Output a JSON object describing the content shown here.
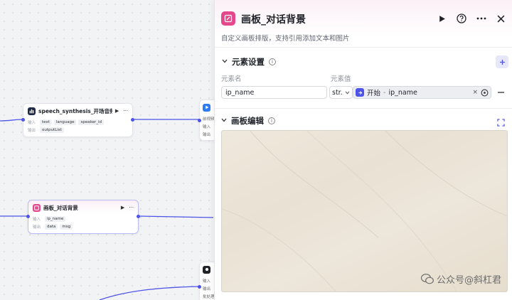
{
  "nodes": {
    "speech": {
      "title": "speech_synthesis_开场音频",
      "input_label": "输入",
      "inputs": [
        "text",
        "language",
        "speaker_id"
      ],
      "output_label": "输出",
      "outputs": [
        "outputList"
      ]
    },
    "board": {
      "title": "画板_对话背景",
      "input_label": "输入",
      "inputs": [
        "ip_name"
      ],
      "output_label": "输出",
      "outputs": [
        "data",
        "msg"
      ]
    },
    "partial_top": {
      "row1": "前视频",
      "row2": "输入",
      "row3": "输出"
    },
    "partial_bottom": {
      "row1": "输入",
      "row2": "输出",
      "row3": "批处理"
    }
  },
  "panel": {
    "title": "画板_对话背景",
    "description": "自定义画板排版，支持引用添加文本和图片",
    "elements_section": "元素设置",
    "col_name": "元素名",
    "col_value": "元素值",
    "element_name": "ip_name",
    "element_type": "str.",
    "ref_source": "开始",
    "ref_sep": "-",
    "ref_field": "ip_name",
    "edit_section": "画板编辑"
  },
  "icons": {
    "run": "play-icon",
    "help": "help-icon",
    "more": "more-icon",
    "close": "close-icon",
    "add": "plus-icon",
    "remove": "minus-icon",
    "expand": "expand-icon"
  },
  "watermark": {
    "text": "公众号@斜杠君"
  },
  "colors": {
    "accent": "#4d53e8",
    "board_icon": "#e5478c",
    "edge": "#4d53e8"
  }
}
